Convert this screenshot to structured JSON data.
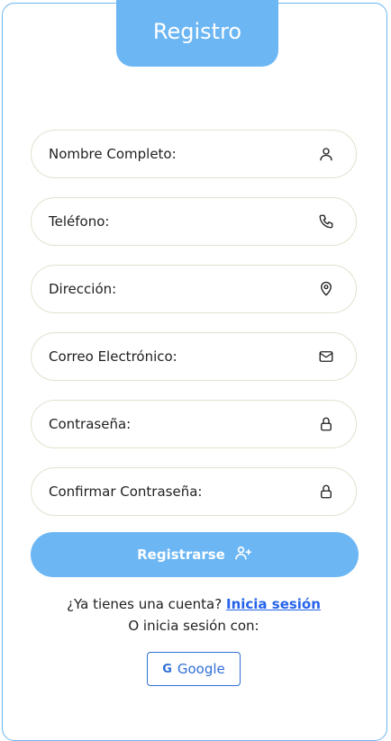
{
  "header": {
    "title": "Registro"
  },
  "form": {
    "fields": [
      {
        "placeholder": "Nombre Completo:",
        "icon": "user-icon"
      },
      {
        "placeholder": "Teléfono:",
        "icon": "phone-icon"
      },
      {
        "placeholder": "Dirección:",
        "icon": "map-pin-icon"
      },
      {
        "placeholder": "Correo Electrónico:",
        "icon": "mail-icon"
      },
      {
        "placeholder": "Contraseña:",
        "icon": "lock-icon"
      },
      {
        "placeholder": "Confirmar Contraseña:",
        "icon": "lock-icon"
      }
    ],
    "submit_label": "Registrarse",
    "submit_icon": "user-plus-icon"
  },
  "footer": {
    "have_account_text": "¿Ya tienes una cuenta?",
    "login_link": "Inicia sesión",
    "alt_login_text": "O inicia sesión con:",
    "google_label": "Google",
    "google_icon": "google-g-icon"
  },
  "colors": {
    "accent": "#6cb6f4",
    "link": "#2563eb",
    "field_border": "#e3e0cf"
  }
}
